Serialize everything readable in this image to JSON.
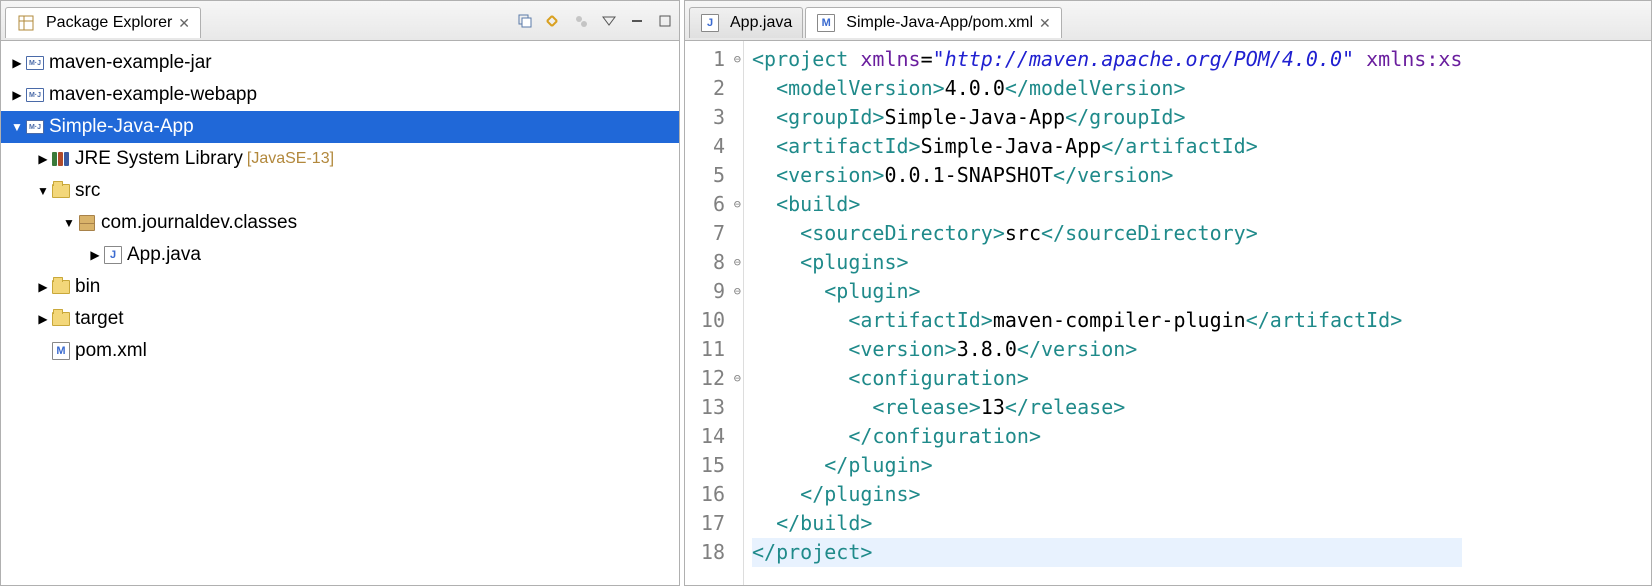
{
  "packageExplorer": {
    "title": "Package Explorer",
    "items": [
      {
        "label": "maven-example-jar"
      },
      {
        "label": "maven-example-webapp"
      },
      {
        "label": "Simple-Java-App"
      },
      {
        "label": "JRE System Library",
        "suffix": "[JavaSE-13]"
      },
      {
        "label": "src"
      },
      {
        "label": "com.journaldev.classes"
      },
      {
        "label": "App.java"
      },
      {
        "label": "bin"
      },
      {
        "label": "target"
      },
      {
        "label": "pom.xml"
      }
    ]
  },
  "editorTabs": {
    "tab1": "App.java",
    "tab2": "Simple-Java-App/pom.xml"
  },
  "code": {
    "lines": [
      {
        "n": "1",
        "fold": "⊖",
        "html": "<span class='tag'>&lt;project</span> <span class='attr-name'>xmlns</span>=<span class='attr-val'>\"http://maven.apache.org/POM/4.0.0\"</span> <span class='attr-name'>xmlns:xs</span>"
      },
      {
        "n": "2",
        "fold": "",
        "html": "  <span class='tag'>&lt;modelVersion&gt;</span><span class='text'>4.0.0</span><span class='tag'>&lt;/modelVersion&gt;</span>"
      },
      {
        "n": "3",
        "fold": "",
        "html": "  <span class='tag'>&lt;groupId&gt;</span><span class='text'>Simple-Java-App</span><span class='tag'>&lt;/groupId&gt;</span>"
      },
      {
        "n": "4",
        "fold": "",
        "html": "  <span class='tag'>&lt;artifactId&gt;</span><span class='text'>Simple-Java-App</span><span class='tag'>&lt;/artifactId&gt;</span>"
      },
      {
        "n": "5",
        "fold": "",
        "html": "  <span class='tag'>&lt;version&gt;</span><span class='text'>0.0.1-SNAPSHOT</span><span class='tag'>&lt;/version&gt;</span>"
      },
      {
        "n": "6",
        "fold": "⊖",
        "html": "  <span class='tag'>&lt;build&gt;</span>"
      },
      {
        "n": "7",
        "fold": "",
        "html": "    <span class='tag'>&lt;sourceDirectory&gt;</span><span class='text'>src</span><span class='tag'>&lt;/sourceDirectory&gt;</span>"
      },
      {
        "n": "8",
        "fold": "⊖",
        "html": "    <span class='tag'>&lt;plugins&gt;</span>"
      },
      {
        "n": "9",
        "fold": "⊖",
        "html": "      <span class='tag'>&lt;plugin&gt;</span>"
      },
      {
        "n": "10",
        "fold": "",
        "html": "        <span class='tag'>&lt;artifactId&gt;</span><span class='text'>maven-compiler-plugin</span><span class='tag'>&lt;/artifactId&gt;</span>"
      },
      {
        "n": "11",
        "fold": "",
        "html": "        <span class='tag'>&lt;version&gt;</span><span class='text'>3.8.0</span><span class='tag'>&lt;/version&gt;</span>"
      },
      {
        "n": "12",
        "fold": "⊖",
        "html": "        <span class='tag'>&lt;configuration&gt;</span>"
      },
      {
        "n": "13",
        "fold": "",
        "html": "          <span class='tag'>&lt;release&gt;</span><span class='text'>13</span><span class='tag'>&lt;/release&gt;</span>"
      },
      {
        "n": "14",
        "fold": "",
        "html": "        <span class='tag'>&lt;/configuration&gt;</span>"
      },
      {
        "n": "15",
        "fold": "",
        "html": "      <span class='tag'>&lt;/plugin&gt;</span>"
      },
      {
        "n": "16",
        "fold": "",
        "html": "    <span class='tag'>&lt;/plugins&gt;</span>"
      },
      {
        "n": "17",
        "fold": "",
        "html": "  <span class='tag'>&lt;/build&gt;</span>"
      },
      {
        "n": "18",
        "fold": "",
        "html": "<span class='tag'>&lt;/project&gt;</span>",
        "current": true
      }
    ]
  }
}
